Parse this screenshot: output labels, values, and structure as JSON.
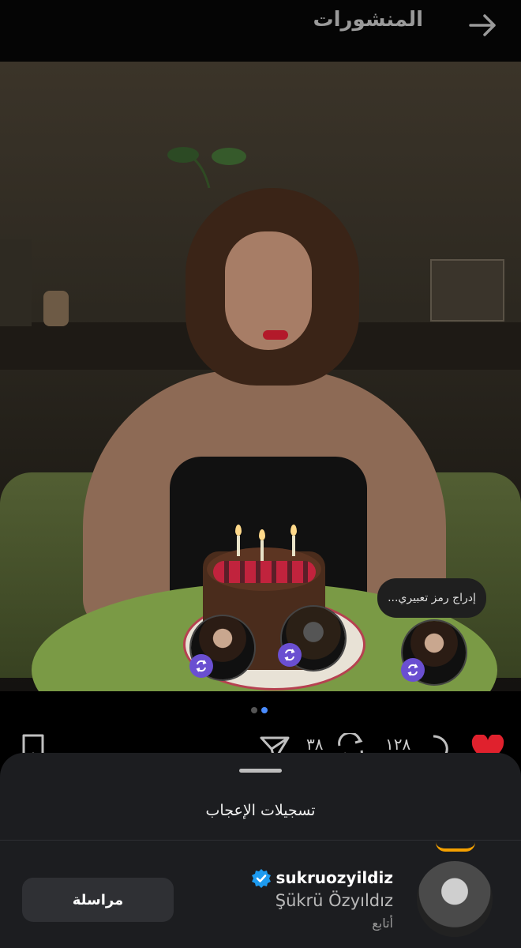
{
  "header": {
    "title": "المنشورات",
    "back_icon": "arrow-right-icon"
  },
  "post": {
    "mention_bubble": "إدراج رمز تعبيري...",
    "carousel": {
      "pages": 2,
      "active_index": 1
    },
    "actions": {
      "like_icon": "heart-filled-icon",
      "like_color": "#e0212d",
      "comment_icon": "comment-icon",
      "comment_count": "١٢٨",
      "repost_icon": "repost-icon",
      "repost_count": "٣٨",
      "share_icon": "send-icon",
      "bookmark_icon": "bookmark-icon"
    }
  },
  "likes_sheet": {
    "title": "تسجيلات الإعجاب",
    "user": {
      "username": "sukruozyildiz",
      "display_name": "Şükrü Özyıldız",
      "follow_status": "أتابع",
      "verified": true,
      "message_button": "مراسلة"
    }
  },
  "colors": {
    "accent_purple": "#6a4fd1",
    "verified_blue": "#1d9bf0",
    "sheet_bg": "#1c1d20"
  }
}
